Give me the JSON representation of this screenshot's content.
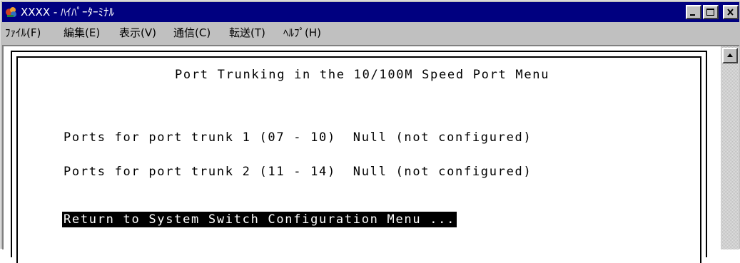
{
  "window": {
    "title": "XXXX - ﾊｲﾊﾟｰﾀｰﾐﾅﾙ",
    "title_bar_color": "#000080",
    "controls": [
      "minimize-icon",
      "maximize-icon",
      "close-icon"
    ]
  },
  "menu": {
    "items": [
      {
        "label": "ﾌｧｲﾙ(F)"
      },
      {
        "label": "編集(E)"
      },
      {
        "label": "表示(V)"
      },
      {
        "label": "通信(C)"
      },
      {
        "label": "転送(T)"
      },
      {
        "label": "ﾍﾙﾌﾟ(H)"
      }
    ]
  },
  "terminal": {
    "title": "Port Trunking in the 10/100M Speed Port Menu",
    "trunk1": "Ports for port trunk 1 (07 - 10)  Null (not configured)",
    "trunk2": "Ports for port trunk 2 (11 - 14)  Null (not configured)",
    "return_item": "Return to System Switch Configuration Menu ..."
  }
}
